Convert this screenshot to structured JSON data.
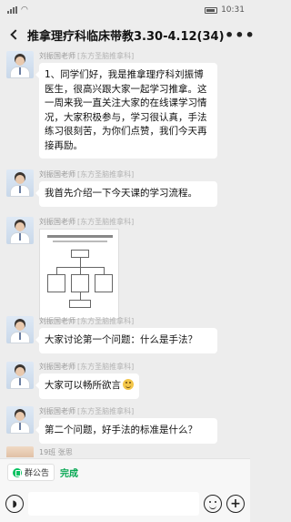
{
  "status_bar": {
    "time": "10:31"
  },
  "title_bar": {
    "title": "推拿理疗科临床带教3.30-4.12(34)",
    "more": "•••"
  },
  "messages": [
    {
      "sender": "刘振国老师",
      "tag": "[东方圣脑推拿科]",
      "text": "1、同学们好，我是推拿理疗科刘振博医生，很高兴跟大家一起学习推拿。这一周来我一直关注大家的在线课学习情况，大家积极参与，学习很认真，手法练习很刻苦，为你们点赞，我们今天再接再励。"
    },
    {
      "sender": "刘振国老师",
      "tag": "[东方圣脑推拿科]",
      "text": "我首先介绍一下今天课的学习流程。"
    },
    {
      "sender": "刘振国老师",
      "tag": "[东方圣脑推拿科]",
      "image_label": "document-image"
    },
    {
      "sender": "刘振国老师",
      "tag": "[东方圣脑推拿科]",
      "text": "大家讨论第一个问题：什么是手法？"
    },
    {
      "sender": "刘振国老师",
      "tag": "[东方圣脑推拿科]",
      "text": "大家可以畅所欲言"
    },
    {
      "sender": "刘振国老师",
      "tag": "[东方圣脑推拿科]",
      "text": "第二个问题，好手法的标准是什么？"
    }
  ],
  "peek": {
    "label": "19班 张思"
  },
  "announcement": {
    "chip_label": "群公告",
    "done_label": "完成"
  },
  "icons": {
    "back": "back-icon",
    "more": "more-icon",
    "voice": "voice-icon",
    "emoji": "emoji-icon",
    "plus": "plus-icon"
  }
}
